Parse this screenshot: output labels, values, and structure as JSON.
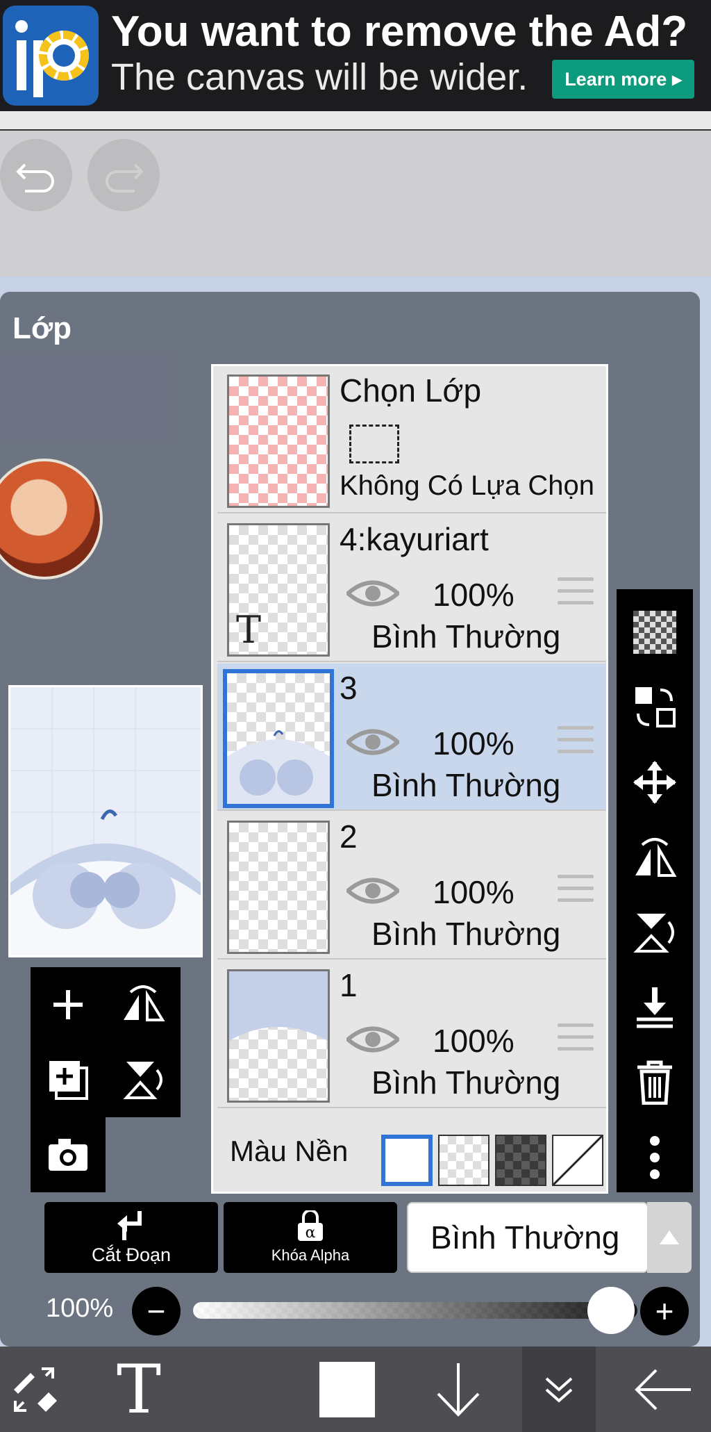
{
  "ad": {
    "title": "You want to remove the Ad?",
    "subtitle": "The canvas will be wider.",
    "learn_more": "Learn more",
    "logo_text": "iP"
  },
  "panel": {
    "title": "Lớp"
  },
  "selection_layer": {
    "title": "Chọn Lớp",
    "status": "Không Có Lựa Chọn"
  },
  "layers": [
    {
      "name": "4:kayuriart",
      "opacity": "100%",
      "blend": "Bình Thường",
      "selected": false,
      "text_layer": true
    },
    {
      "name": "3",
      "opacity": "100%",
      "blend": "Bình Thường",
      "selected": true,
      "text_layer": false
    },
    {
      "name": "2",
      "opacity": "100%",
      "blend": "Bình Thường",
      "selected": false,
      "text_layer": false
    },
    {
      "name": "1",
      "opacity": "100%",
      "blend": "Bình Thường",
      "selected": false,
      "text_layer": false
    }
  ],
  "background": {
    "label": "Màu Nền"
  },
  "buttons": {
    "clipping": "Cắt Đoạn",
    "alpha_lock": "Khóa Alpha",
    "blend_mode": "Bình Thường"
  },
  "opacity": {
    "value_text": "100%",
    "value": 1.0,
    "minus": "−",
    "plus": "+"
  },
  "text_tool_glyph": "T",
  "colors": {
    "selected_border": "#2f74d6",
    "ad_button": "#0d9b7e"
  }
}
